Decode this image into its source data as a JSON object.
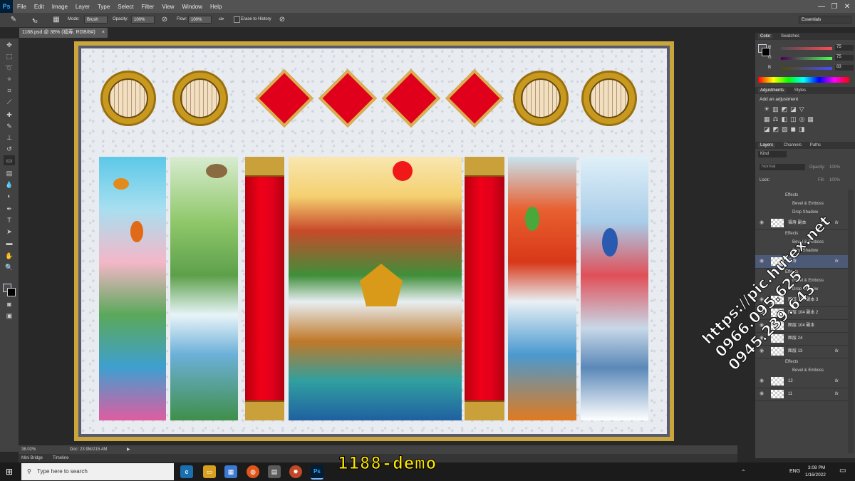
{
  "app": {
    "logo": "Ps"
  },
  "menu": [
    "File",
    "Edit",
    "Image",
    "Layer",
    "Type",
    "Select",
    "Filter",
    "View",
    "Window",
    "Help"
  ],
  "window_controls": {
    "minimize": "—",
    "restore": "❐",
    "close": "✕"
  },
  "options_bar": {
    "brush_size": "43",
    "mode_label": "Mode:",
    "mode_value": "Brush",
    "opacity_label": "Opacity:",
    "opacity_value": "100%",
    "flow_label": "Flow:",
    "flow_value": "100%",
    "erase_history": "Erase to History",
    "workspace": "Essentials"
  },
  "document_tab": {
    "title": "1188.psd @ 38% (福寿, RGB/8#)",
    "close": "×"
  },
  "color_panel": {
    "tabs": [
      "Color",
      "Swatches"
    ],
    "r_label": "R",
    "r_value": "75",
    "g_label": "G",
    "g_value": "75",
    "b_label": "B",
    "b_value": "83"
  },
  "adjustments_panel": {
    "tabs": [
      "Adjustments",
      "Styles"
    ],
    "heading": "Add an adjustment"
  },
  "layers_panel": {
    "tabs": [
      "Layers",
      "Channels",
      "Paths"
    ],
    "filter": "Kind",
    "blend_mode": "Normal",
    "opacity_label": "Opacity:",
    "opacity_value": "100%",
    "lock_label": "Lock:",
    "fill_label": "Fill:",
    "fill_value": "100%",
    "rows": [
      {
        "kind": "sub",
        "text": "Effects"
      },
      {
        "kind": "sub",
        "text": "Bevel & Emboss"
      },
      {
        "kind": "sub",
        "text": "Drop Shadow"
      },
      {
        "kind": "layer",
        "text": "福寿 副本",
        "fx": "fx"
      },
      {
        "kind": "sub",
        "text": "Effects"
      },
      {
        "kind": "sub",
        "text": "Bevel & Emboss"
      },
      {
        "kind": "sub",
        "text": "Drop Shadow"
      },
      {
        "kind": "layer",
        "text": "福寿",
        "fx": "fx"
      },
      {
        "kind": "sub",
        "text": "Effects"
      },
      {
        "kind": "sub",
        "text": "Bevel & Emboss"
      },
      {
        "kind": "sub",
        "text": "Drop Shadow"
      },
      {
        "kind": "layer",
        "text": "图层 104 副本 3",
        "fx": ""
      },
      {
        "kind": "layer",
        "text": "图层 104 副本 2",
        "fx": ""
      },
      {
        "kind": "layer",
        "text": "图层 104 副本",
        "fx": ""
      },
      {
        "kind": "layer",
        "text": "图层 24",
        "fx": ""
      },
      {
        "kind": "layer",
        "text": "图层 13",
        "fx": "fx"
      },
      {
        "kind": "sub",
        "text": "Effects"
      },
      {
        "kind": "sub",
        "text": "Bevel & Emboss"
      },
      {
        "kind": "layer",
        "text": "12",
        "fx": "fx"
      },
      {
        "kind": "layer",
        "text": "11",
        "fx": "fx"
      }
    ]
  },
  "status_bar": {
    "zoom": "38.02%",
    "doc": "Doc: 23.9M/215.4M"
  },
  "mini_bar": {
    "tabs": [
      "Mini Bridge",
      "Timeline"
    ]
  },
  "taskbar": {
    "search_placeholder": "Type here to search",
    "lang": "ENG",
    "time": "3:08 PM",
    "date": "1/16/2022"
  },
  "overlay": {
    "demo_label": "1188-demo",
    "watermark": [
      "https://pic.hutex.net",
      "0966.095.625",
      "0945.239.643"
    ]
  },
  "colors": {
    "accent_red": "#e0001b",
    "gold": "#c9a63c",
    "ps_blue": "#31a8ff",
    "demo_yellow": "#ffe600"
  }
}
